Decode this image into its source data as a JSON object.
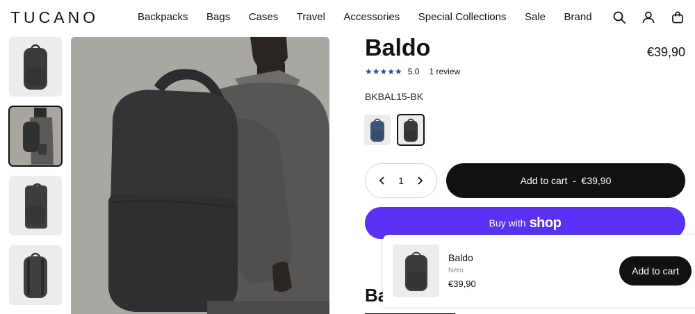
{
  "brand": {
    "logo": "TUCANO"
  },
  "nav": {
    "items": [
      "Backpacks",
      "Bags",
      "Cases",
      "Travel",
      "Accessories",
      "Special Collections",
      "Sale",
      "Brand"
    ]
  },
  "header_icons": [
    "search-icon",
    "account-icon",
    "cart-bag-icon"
  ],
  "product": {
    "title": "Baldo",
    "price": "€39,90",
    "stars": "★★★★★",
    "rating": "5.0",
    "reviews": "1 review",
    "sku": "BKBAL15-BK",
    "quantity": "1",
    "add_to_cart": "Add to cart  -  €39,90",
    "buy_with": "Buy with",
    "shop_word": "shop",
    "swatch_colors": [
      "#3d5679",
      "#3a3a3a"
    ]
  },
  "description_title_partial": "Ba",
  "sticky_bar": {
    "name": "Baldo",
    "variant": "Nero",
    "price": "€39,90",
    "button": "Add to cart"
  },
  "colors": {
    "shop_pay": "#5a31f4",
    "primary_button": "#111111",
    "star": "#1e4e9e"
  }
}
